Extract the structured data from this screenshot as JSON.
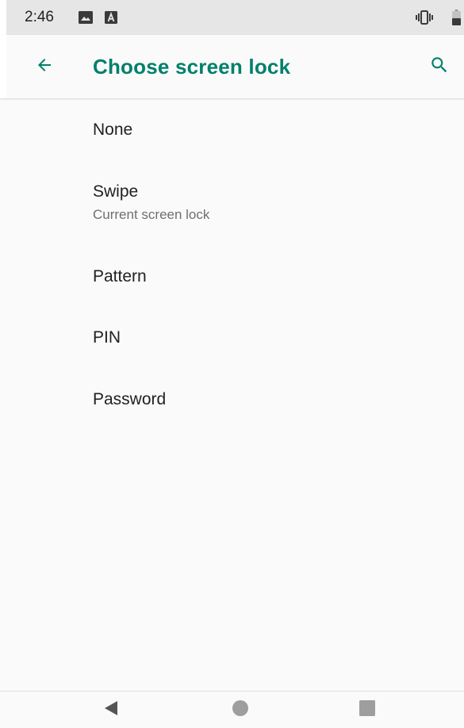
{
  "status_bar": {
    "time": "2:46",
    "icons": [
      "image-icon",
      "a-icon",
      "vibrate-icon",
      "battery-icon"
    ]
  },
  "app_bar": {
    "title": "Choose screen lock",
    "back_icon": "back-arrow-icon",
    "search_icon": "search-icon",
    "accent_color": "#00806b"
  },
  "options": [
    {
      "title": "None",
      "summary": ""
    },
    {
      "title": "Swipe",
      "summary": "Current screen lock"
    },
    {
      "title": "Pattern",
      "summary": ""
    },
    {
      "title": "PIN",
      "summary": ""
    },
    {
      "title": "Password",
      "summary": ""
    }
  ],
  "nav_bar": {
    "icons": [
      "nav-back-icon",
      "nav-home-icon",
      "nav-recents-icon"
    ]
  }
}
